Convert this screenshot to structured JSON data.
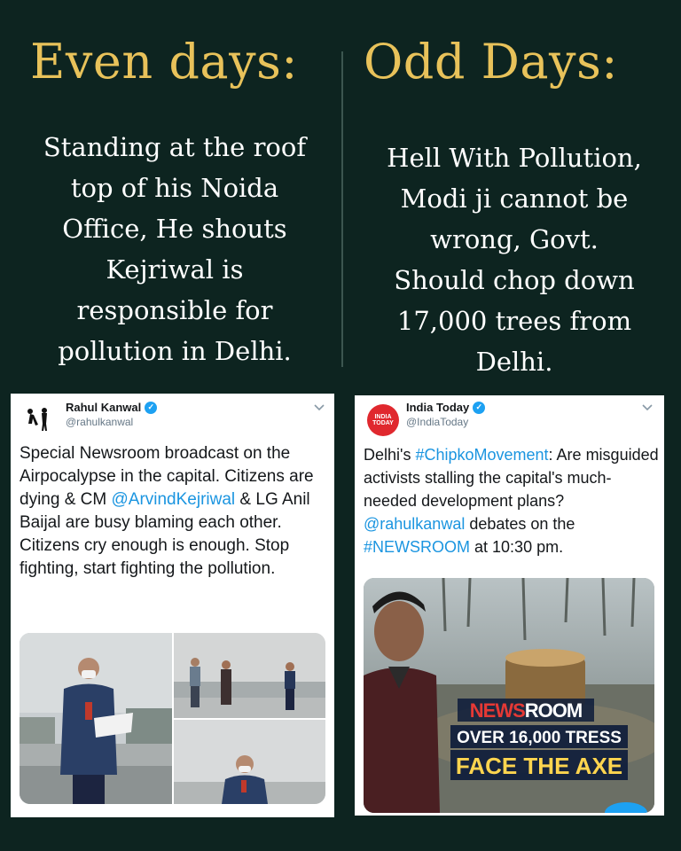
{
  "left": {
    "heading": "Even days:",
    "lines": [
      "Standing at the roof",
      "top of his Noida",
      "Office, He shouts",
      "Kejriwal is",
      "responsible for",
      "pollution in Delhi."
    ]
  },
  "right": {
    "heading": "Odd Days:",
    "lines": [
      "Hell With Pollution,",
      "Modi ji cannot be",
      "wrong, Govt.",
      "Should chop down",
      "17,000 trees from",
      "Delhi."
    ]
  },
  "tweet1": {
    "name": "Rahul Kanwal",
    "handle": "@rahulkanwal",
    "text_1": "Special Newsroom broadcast on the Airpocalypse in the capital. Citizens are dying & CM ",
    "mention": "@ArvindKejriwal",
    "text_2": " & LG Anil Baijal are busy blaming each other. Citizens cry enough is enough. Stop fighting, start fighting the pollution."
  },
  "tweet2": {
    "name": "India Today",
    "handle": "@IndiaToday",
    "logo_line1": "INDIA",
    "logo_line2": "TODAY",
    "text_1": "Delhi's ",
    "hashtag1": "#ChipkoMovement",
    "text_2": ": Are misguided activists stalling the capital's much-needed development plans? ",
    "mention": "@rahulkanwal",
    "text_3": " debates on the ",
    "hashtag2": "#NEWSROOM",
    "text_4": " at 10:30 pm.",
    "media_brand": "NEWSROOM",
    "media_brand_news": "NEWS",
    "media_brand_room": "ROOM",
    "media_line1": "OVER 16,000 TRESS",
    "media_line2": "FACE THE AXE"
  },
  "icons": {
    "verified": "verified-check-icon",
    "chevron": "chevron-down-icon"
  },
  "colors": {
    "background": "#0d2420",
    "heading": "#e8c25a",
    "link": "#1b95e0",
    "verified": "#1da1f2"
  }
}
